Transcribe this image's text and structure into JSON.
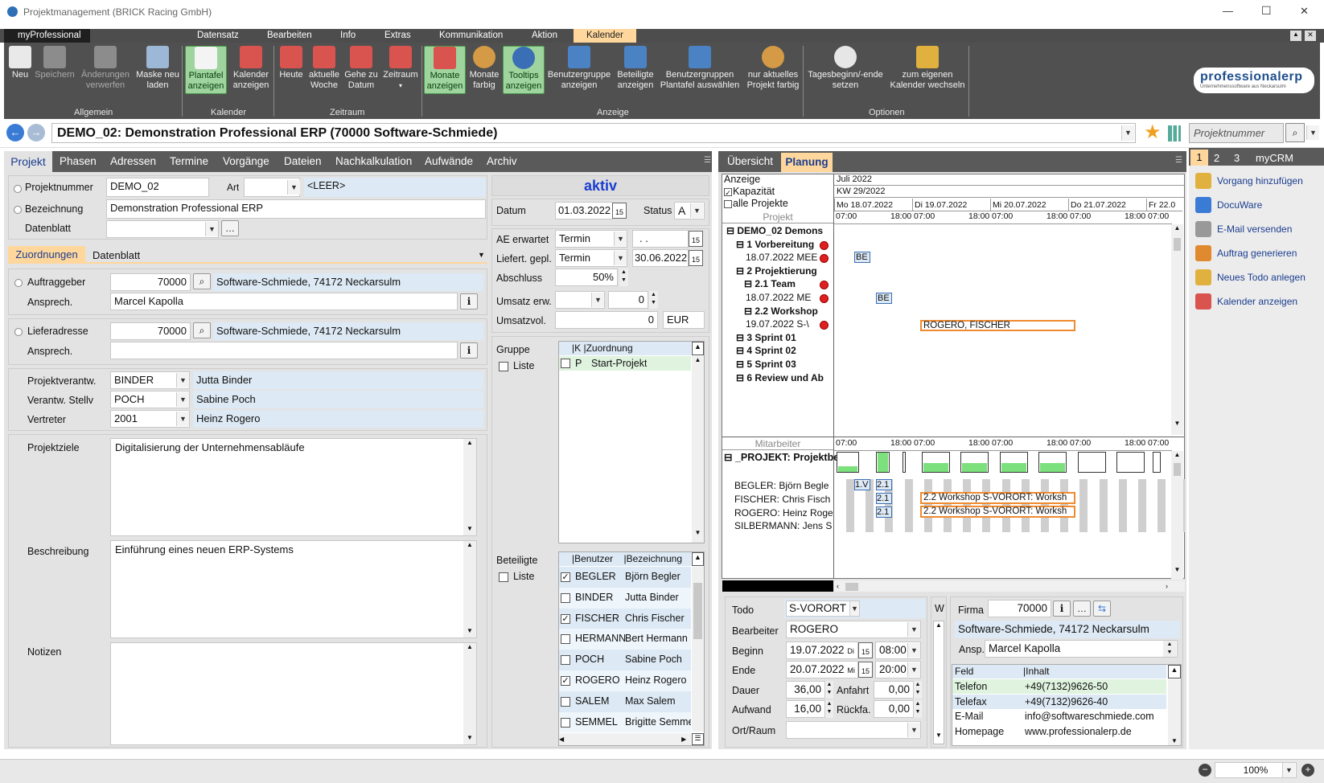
{
  "window": {
    "title": "Projektmanagement (BRICK Racing GmbH)",
    "brand": "myProfessional",
    "min": "—",
    "max": "☐",
    "close": "✕"
  },
  "ribbon": {
    "tabs": [
      "Datensatz",
      "Bearbeiten",
      "Info",
      "Extras",
      "Kommunikation",
      "Aktion",
      "Kalender"
    ],
    "active_tab": "Kalender",
    "buttons": [
      {
        "label": "Neu",
        "icon": "new-icon"
      },
      {
        "label": "Speichern",
        "icon": "save-icon"
      },
      {
        "label": "Änderungen verwerfen",
        "icon": "undo-icon"
      },
      {
        "label": "Maske neu laden",
        "icon": "reload-icon"
      },
      {
        "label": "Plantafel anzeigen",
        "icon": "planboard-icon"
      },
      {
        "label": "Kalender anzeigen",
        "icon": "calendar-icon"
      },
      {
        "label": "Heute",
        "icon": "calendar-today-icon"
      },
      {
        "label": "aktuelle Woche",
        "icon": "calendar-week-icon"
      },
      {
        "label": "Gehe zu Datum",
        "icon": "calendar-goto-icon"
      },
      {
        "label": "Zeitraum",
        "icon": "calendar-range-icon"
      },
      {
        "label": "Monate anzeigen",
        "icon": "calendar-month-icon"
      },
      {
        "label": "Monate farbig",
        "icon": "palette-icon"
      },
      {
        "label": "Tooltips anzeigen",
        "icon": "info-icon"
      },
      {
        "label": "Benutzergruppe anzeigen",
        "icon": "usergroup-icon"
      },
      {
        "label": "Beteiligte anzeigen",
        "icon": "participants-icon"
      },
      {
        "label": "Benutzergruppen Plantafel auswählen",
        "icon": "usergroup-select-icon"
      },
      {
        "label": "nur aktuelles Projekt farbig",
        "icon": "palette-project-icon"
      },
      {
        "label": "Tagesbeginn/-ende setzen",
        "icon": "clock-icon"
      },
      {
        "label": "zum eigenen Kalender wechseln",
        "icon": "user-calendar-icon"
      }
    ],
    "groups": [
      "Allgemein",
      "Kalender",
      "Zeitraum",
      "Anzeige",
      "Optionen"
    ],
    "logo": "professionalerp",
    "logo_sub": "Unternehmenssoftware aus Neckarsulm"
  },
  "record": {
    "title": "DEMO_02: Demonstration Professional ERP (70000 Software-Schmiede)",
    "search_placeholder": "Projektnummer"
  },
  "left_tabs": [
    "Projekt",
    "Phasen",
    "Adressen",
    "Termine",
    "Vorgänge",
    "Dateien",
    "Nachkalkulation",
    "Aufwände",
    "Archiv"
  ],
  "project": {
    "projektnummer_label": "Projektnummer",
    "projektnummer": "DEMO_02",
    "art_label": "Art",
    "art_value": "<LEER>",
    "bezeichnung_label": "Bezeichnung",
    "bezeichnung": "Demonstration Professional ERP",
    "datenblatt_label": "Datenblatt",
    "subtabs": [
      "Zuordnungen",
      "Datenblatt"
    ],
    "auftraggeber_label": "Auftraggeber",
    "auftraggeber_nr": "70000",
    "auftraggeber_name": "Software-Schmiede, 74172 Neckarsulm",
    "ansprech_label": "Ansprech.",
    "ansprech": "Marcel Kapolla",
    "lieferadresse_label": "Lieferadresse",
    "lieferadresse_nr": "70000",
    "lieferadresse_name": "Software-Schmiede, 74172 Neckarsulm",
    "verantw_label": "Projektverantw.",
    "verantw_code": "BINDER",
    "verantw_name": "Jutta Binder",
    "stellv_label": "Verantw. Stellv",
    "stellv_code": "POCH",
    "stellv_name": "Sabine Poch",
    "vertreter_label": "Vertreter",
    "vertreter_code": "2001",
    "vertreter_name": "Heinz Rogero",
    "ziele_label": "Projektziele",
    "ziele": "Digitalisierung der Unternehmensabläufe",
    "beschreibung_label": "Beschreibung",
    "beschreibung": "Einführung eines neuen ERP-Systems",
    "notizen_label": "Notizen"
  },
  "status": {
    "state": "aktiv",
    "datum_label": "Datum",
    "datum": "01.03.2022",
    "status_label": "Status",
    "status_value": "A",
    "ae_label": "AE erwartet",
    "ae_value": "Termin",
    "ae_date": ". .",
    "liefert_label": "Liefert. gepl.",
    "liefert_value": "Termin",
    "liefert_date": "30.06.2022",
    "abschluss_label": "Abschluss",
    "abschluss": "50%",
    "umsatz_label": "Umsatz erw.",
    "umsatz": "0",
    "umsatzvol_label": "Umsatzvol.",
    "umsatzvol": "0",
    "currency": "EUR",
    "gruppe_label": "Gruppe",
    "liste_label": "Liste",
    "gruppe_headers": [
      "K",
      "Zuordnung"
    ],
    "gruppe_rows": [
      {
        "k": "P",
        "z": "Start-Projekt"
      }
    ],
    "beteiligte_label": "Beteiligte",
    "beteiligte_headers": [
      "Benutzer",
      "Bezeichnung"
    ],
    "beteiligte": [
      {
        "u": "BEGLER",
        "n": "Björn Begler",
        "checked": true
      },
      {
        "u": "BINDER",
        "n": "Jutta Binder",
        "checked": false
      },
      {
        "u": "FISCHER",
        "n": "Chris Fischer",
        "checked": true
      },
      {
        "u": "HERMANN",
        "n": "Bert Hermann",
        "checked": false
      },
      {
        "u": "POCH",
        "n": "Sabine Poch",
        "checked": false
      },
      {
        "u": "ROGERO",
        "n": "Heinz Rogero",
        "checked": true
      },
      {
        "u": "SALEM",
        "n": "Max Salem",
        "checked": false
      },
      {
        "u": "SEMMEL",
        "n": "Brigitte Semme",
        "checked": false
      }
    ]
  },
  "right_tabs": [
    "Übersicht",
    "Planung"
  ],
  "gantt": {
    "anzeige": "Anzeige",
    "kapazitaet": "Kapazität",
    "alle": "alle Projekte",
    "month": "Juli 2022",
    "week": "KW 29/2022",
    "days": [
      "Mo 18.07.2022",
      "Di 19.07.2022",
      "Mi 20.07.2022",
      "Do 21.07.2022",
      "Fr 22.0"
    ],
    "t1": "07:00",
    "t2": "18:00",
    "col_projekt": "Projekt",
    "col_mitarbeiter": "Mitarbeiter",
    "tree": [
      {
        "label": "DEMO_02 Demons",
        "lvl": 0
      },
      {
        "label": "1 Vorbereitung",
        "lvl": 1
      },
      {
        "label": "18.07.2022 MEE",
        "lvl": 2
      },
      {
        "label": "2 Projektierung",
        "lvl": 1
      },
      {
        "label": "2.1 Team",
        "lvl": 2
      },
      {
        "label": "18.07.2022 ME",
        "lvl": 3
      },
      {
        "label": "2.2 Workshop",
        "lvl": 2
      },
      {
        "label": "19.07.2022 S-\\",
        "lvl": 3
      },
      {
        "label": "3 Sprint 01",
        "lvl": 1
      },
      {
        "label": "4 Sprint 02",
        "lvl": 1
      },
      {
        "label": "5 Sprint 03",
        "lvl": 1
      },
      {
        "label": "6 Review und Ab",
        "lvl": 1
      }
    ],
    "bars": {
      "be": "BE",
      "workshop": "ROGERO, FISCHER"
    },
    "staff_head": "_PROJEKT: Projektbe",
    "staff": [
      "BEGLER: Björn Begle",
      "FISCHER: Chris Fisch",
      "ROGERO: Heinz Roge",
      "SILBERMANN: Jens S"
    ],
    "staff_bars": {
      "v1": "1.V",
      "s21": "2.1",
      "ws": "2.2 Workshop S-VORORT: Worksh"
    }
  },
  "todo": {
    "todo_label": "Todo",
    "todo": "S-VORORT",
    "bearbeiter_label": "Bearbeiter",
    "bearbeiter": "ROGERO",
    "beginn_label": "Beginn",
    "beginn_date": "19.07.2022",
    "beginn_day": "Di",
    "beginn_time": "08:00",
    "ende_label": "Ende",
    "ende_date": "20.07.2022",
    "ende_day": "Mi",
    "ende_time": "20:00",
    "dauer_label": "Dauer",
    "dauer": "36,00",
    "anfahrt_label": "Anfahrt",
    "anfahrt": "0,00",
    "aufwand_label": "Aufwand",
    "aufwand": "16,00",
    "rueck_label": "Rückfa.",
    "rueck": "0,00",
    "ort_label": "Ort/Raum",
    "w": "W"
  },
  "firma": {
    "label": "Firma",
    "nr": "70000",
    "name": "Software-Schmiede, 74172 Neckarsulm",
    "ansp_label": "Ansp.",
    "ansp": "Marcel Kapolla",
    "headers": [
      "Feld",
      "Inhalt"
    ],
    "rows": [
      {
        "f": "Telefon",
        "v": "+49(7132)9626-50"
      },
      {
        "f": "Telefax",
        "v": "+49(7132)9626-40"
      },
      {
        "f": "E-Mail",
        "v": "info@softwareschmiede.com"
      },
      {
        "f": "Homepage",
        "v": "www.professionalerp.de"
      }
    ]
  },
  "crm": {
    "tabs": [
      "1",
      "2",
      "3",
      "myCRM"
    ],
    "actions": [
      {
        "label": "Vorgang hinzufügen",
        "icon": "add-process-icon"
      },
      {
        "label": "DocuWare",
        "icon": "docuware-icon"
      },
      {
        "label": "E-Mail versenden",
        "icon": "email-icon"
      },
      {
        "label": "Auftrag generieren",
        "icon": "order-icon"
      },
      {
        "label": "Neues Todo anlegen",
        "icon": "todo-icon"
      },
      {
        "label": "Kalender anzeigen",
        "icon": "calendar-icon"
      }
    ]
  },
  "statusbar": {
    "zoom": "100%"
  },
  "colors": {
    "accent": "#ffd79c",
    "ribbon": "#505050",
    "nav": "#3a7bd5",
    "field_blue": "#dde9f4"
  }
}
